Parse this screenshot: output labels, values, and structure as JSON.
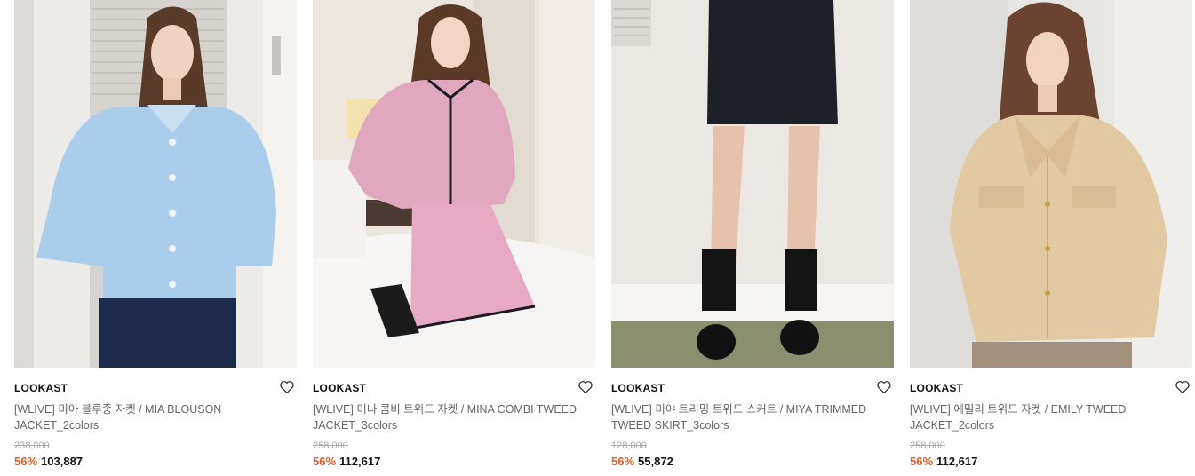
{
  "colors": {
    "accent": "#e45b25",
    "brand_text": "#111111",
    "name_text": "#666666",
    "original_price": "#aaaaaa"
  },
  "products": [
    {
      "brand": "LOOKAST",
      "name": "[WLIVE] 미아 블루종 자켓 / MIA BLOUSON JACKET_2colors",
      "original_price": "238,000",
      "discount": "56%",
      "price": "103,887",
      "wishlist_icon": "heart-outline-icon"
    },
    {
      "brand": "LOOKAST",
      "name": "[WLIVE] 미나 콤비 트위드 자켓 / MINA COMBI TWEED JACKET_3colors",
      "original_price": "258,000",
      "discount": "56%",
      "price": "112,617",
      "wishlist_icon": "heart-outline-icon"
    },
    {
      "brand": "LOOKAST",
      "name": "[WLIVE] 미야 트리밍 트위드 스커트 / MIYA TRIMMED TWEED SKIRT_3colors",
      "original_price": "128,000",
      "discount": "56%",
      "price": "55,872",
      "wishlist_icon": "heart-outline-icon"
    },
    {
      "brand": "LOOKAST",
      "name": "[WLIVE] 에밀리 트위드 자켓 / EMILY TWEED JACKET_2colors",
      "original_price": "258,000",
      "discount": "56%",
      "price": "112,617",
      "wishlist_icon": "heart-outline-icon"
    }
  ]
}
